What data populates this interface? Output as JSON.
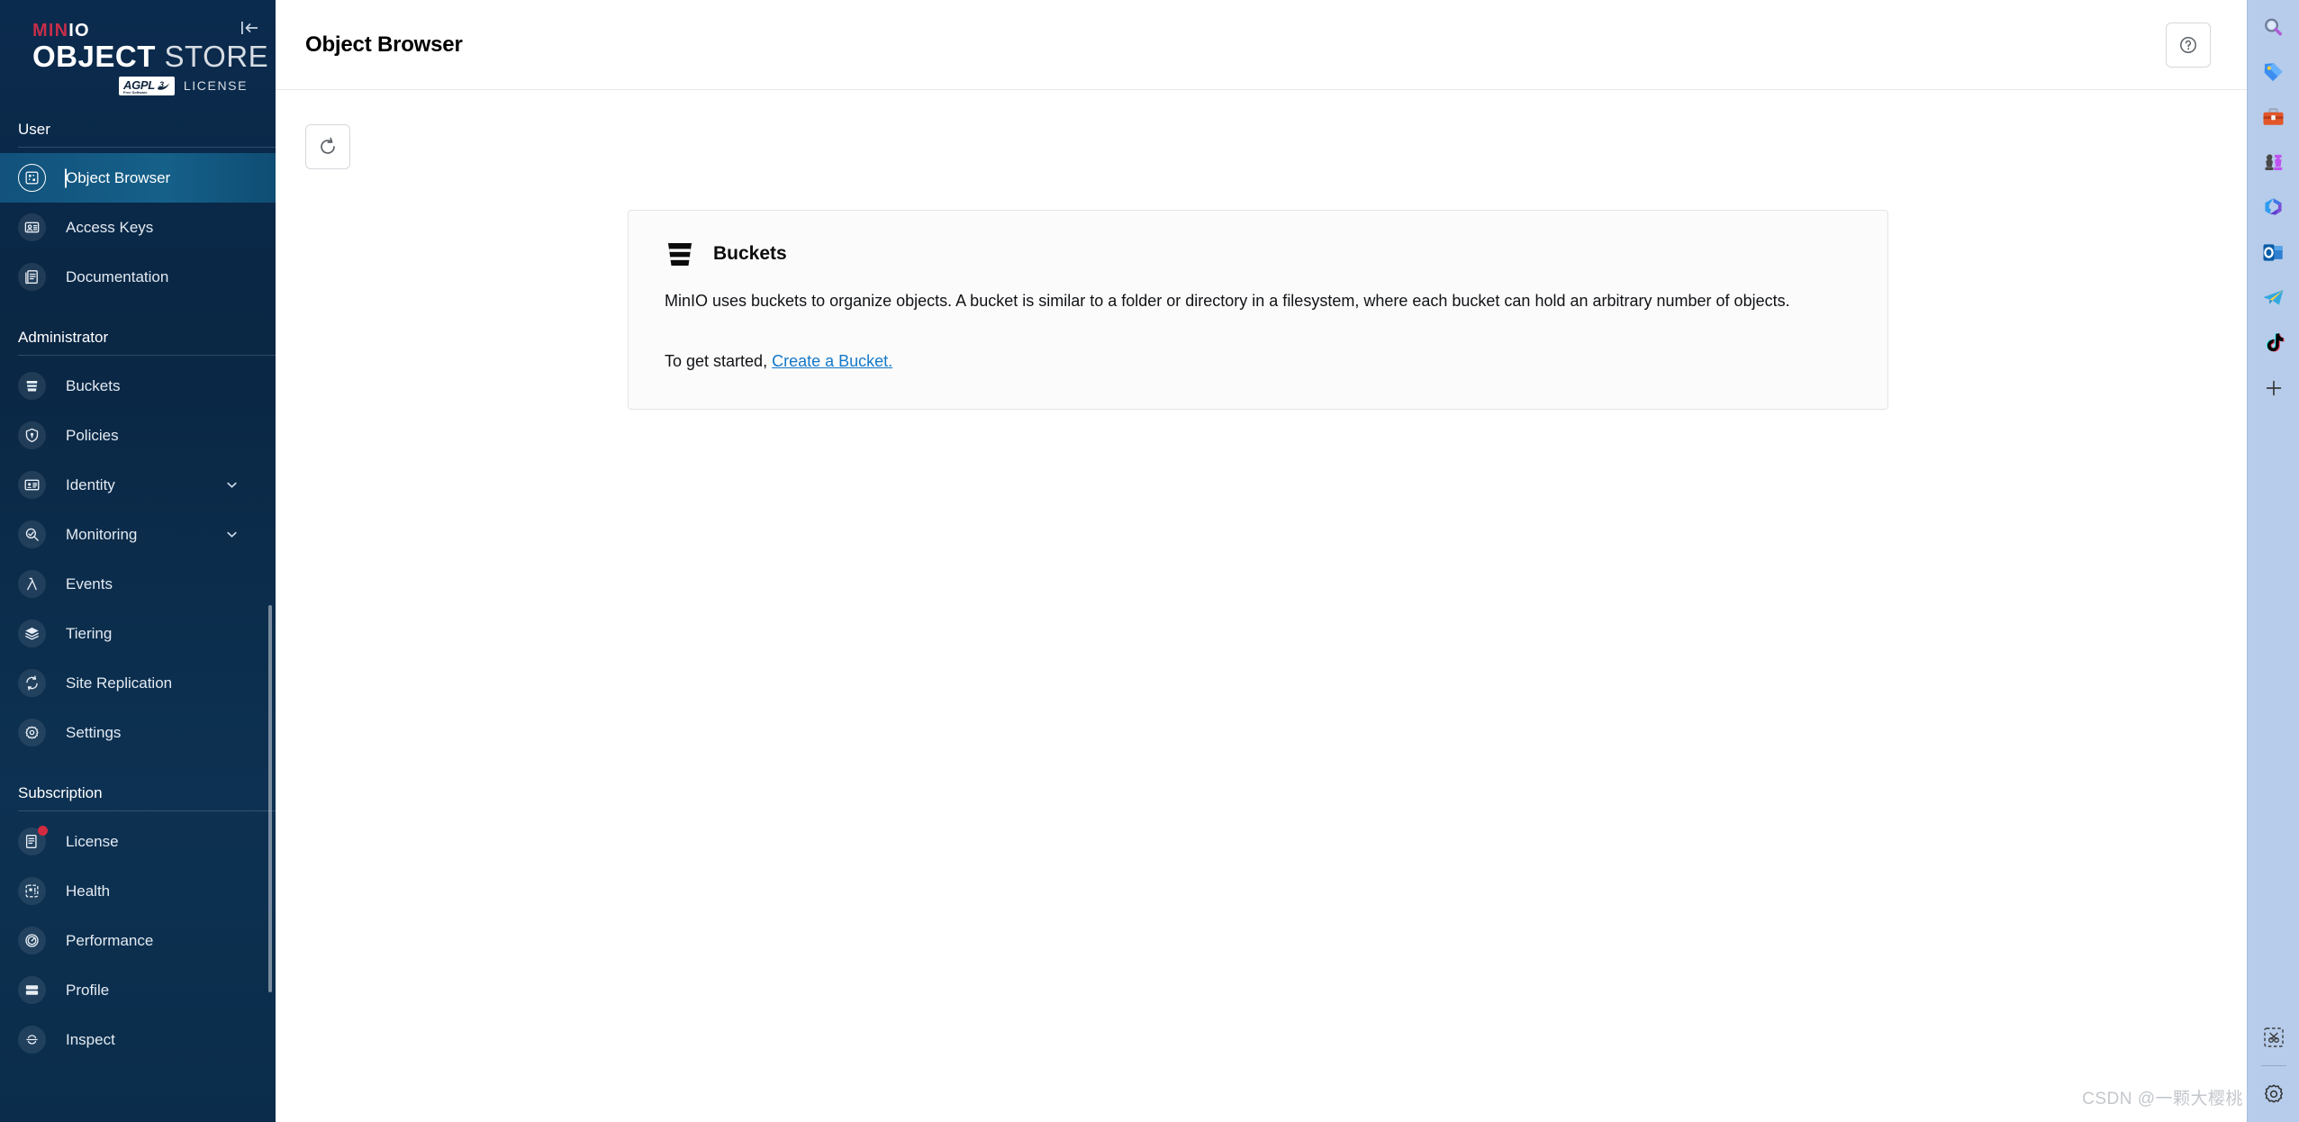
{
  "brand": {
    "minio_min": "MIN",
    "minio_io": "IO",
    "object": "OBJECT",
    "store": " STORE",
    "agpl": "AGPL",
    "agpl_sub": "Free Software",
    "agpl_v": "v3",
    "license_word": "LICENSE",
    "collapse_icon": "collapse-left-icon"
  },
  "sidebar": {
    "groups": [
      {
        "title": "User",
        "items": [
          {
            "label": "Object Browser",
            "icon": "object-browser-icon",
            "active": true,
            "chevron": false,
            "badge": false
          },
          {
            "label": "Access Keys",
            "icon": "access-keys-icon",
            "active": false,
            "chevron": false,
            "badge": false
          },
          {
            "label": "Documentation",
            "icon": "documentation-icon",
            "active": false,
            "chevron": false,
            "badge": false
          }
        ]
      },
      {
        "title": "Administrator",
        "items": [
          {
            "label": "Buckets",
            "icon": "bucket-icon",
            "active": false,
            "chevron": false,
            "badge": false
          },
          {
            "label": "Policies",
            "icon": "policies-lock-icon",
            "active": false,
            "chevron": false,
            "badge": false
          },
          {
            "label": "Identity",
            "icon": "identity-card-icon",
            "active": false,
            "chevron": true,
            "badge": false
          },
          {
            "label": "Monitoring",
            "icon": "monitoring-search-icon",
            "active": false,
            "chevron": true,
            "badge": false
          },
          {
            "label": "Events",
            "icon": "events-lambda-icon",
            "active": false,
            "chevron": false,
            "badge": false
          },
          {
            "label": "Tiering",
            "icon": "tiering-layers-icon",
            "active": false,
            "chevron": false,
            "badge": false
          },
          {
            "label": "Site Replication",
            "icon": "site-replication-icon",
            "active": false,
            "chevron": false,
            "badge": false
          },
          {
            "label": "Settings",
            "icon": "settings-gear-icon",
            "active": false,
            "chevron": false,
            "badge": false
          }
        ]
      },
      {
        "title": "Subscription",
        "items": [
          {
            "label": "License",
            "icon": "license-doc-icon",
            "active": false,
            "chevron": false,
            "badge": true
          },
          {
            "label": "Health",
            "icon": "health-icon",
            "active": false,
            "chevron": false,
            "badge": false
          },
          {
            "label": "Performance",
            "icon": "performance-gauge-icon",
            "active": false,
            "chevron": false,
            "badge": false
          },
          {
            "label": "Profile",
            "icon": "profile-icon",
            "active": false,
            "chevron": false,
            "badge": false
          },
          {
            "label": "Inspect",
            "icon": "inspect-icon",
            "active": false,
            "chevron": false,
            "badge": false
          }
        ]
      }
    ]
  },
  "header": {
    "title": "Object Browser",
    "help_icon": "help-circle-icon"
  },
  "toolbar": {
    "refresh_icon": "refresh-icon"
  },
  "card": {
    "icon": "bucket-icon",
    "title": "Buckets",
    "paragraph": "MinIO uses buckets to organize objects. A bucket is similar to a folder or directory in a filesystem, where each bucket can hold an arbitrary number of objects.",
    "cta_prefix": "To get started, ",
    "cta_link": "Create a Bucket."
  },
  "rail": {
    "top_icons": [
      {
        "name": "search-icon"
      },
      {
        "name": "shopping-tag-icon"
      },
      {
        "name": "tools-briefcase-icon"
      },
      {
        "name": "games-chess-icon"
      },
      {
        "name": "microsoft-365-icon"
      },
      {
        "name": "outlook-icon"
      },
      {
        "name": "telegram-icon"
      },
      {
        "name": "tiktok-icon"
      },
      {
        "name": "add-sidebar-icon"
      }
    ],
    "bottom_icons": [
      {
        "name": "screenshot-snip-icon"
      },
      {
        "name": "settings-gear-icon"
      }
    ]
  },
  "watermark": {
    "text": "CSDN @一颗大樱桃"
  }
}
